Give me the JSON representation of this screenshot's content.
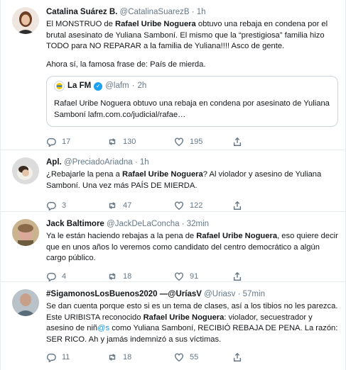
{
  "tweets": [
    {
      "name": "Catalina Suárez B.",
      "handle": "@CatalinaSuarezB",
      "dot": "·",
      "time": "1h",
      "b1": "El MONSTRUO de ",
      "b2": "Rafael Uribe Noguera",
      "b3": " obtuvo una rebaja en condena por el brutal asesinato de Yuliana Samboní. El mismo que la “prestigiosa” familia hizo TODO para NO REPARAR a la familia de Yuliana!!!! Asco de gente.",
      "p2": "Ahora sí, la famosa frase de: País de mierda.",
      "quote": {
        "name": "La FM",
        "verified": "✓",
        "handle": "@lafm",
        "dot": "·",
        "time": "2h",
        "text": "Rafael Uribe Noguera obtuvo una rebaja en condena por asesinato de Yuliana Samboní lafm.com.co/judicial/rafae…"
      },
      "replies": "17",
      "retweets": "130",
      "likes": "195"
    },
    {
      "name": "Apl.",
      "handle": "@PreciadoAriadna",
      "dot": "·",
      "time": "1h",
      "b1": "¿Rebajarle la pena a ",
      "b2": "Rafael Uribe Noguera",
      "b3": "? Al violador y asesino de Yuliana Samboní. Una vez más PAÍS DE MIERDA.",
      "replies": "3",
      "retweets": "47",
      "likes": "122"
    },
    {
      "name": "Jack Baltimore",
      "handle": "@JackDeLaConcha",
      "dot": "·",
      "time": "32min",
      "b1": "Ya le están haciendo rebajas a la pena de ",
      "b2": "Rafael Uribe Noguera",
      "b3": ", eso quiere decir que en unos años lo veremos como candidato del centro democrático a algún cargo público.",
      "replies": "4",
      "retweets": "18",
      "likes": "91"
    },
    {
      "name": "#SigamonosLosBuenos2020 —@UríasV",
      "handle": "@Uriasv",
      "dot": "·",
      "time": "57min",
      "b1": "Se dan cuenta porque esto si es un tema de clases, así a los tibios no les parezca. Este URIBISTA reconocido ",
      "b2": "Rafael Uribe Noguera",
      "b3": ": violador, secuestrador y asesino de niñ",
      "b4": "@s",
      "b5": " como Yuliana Samboní, RECIBIÓ REBAJA DE PENA. La razón: SER RICO. Ah y jamás indemnizó a sus víctimas.",
      "replies": "11",
      "retweets": "18",
      "likes": "55"
    }
  ]
}
